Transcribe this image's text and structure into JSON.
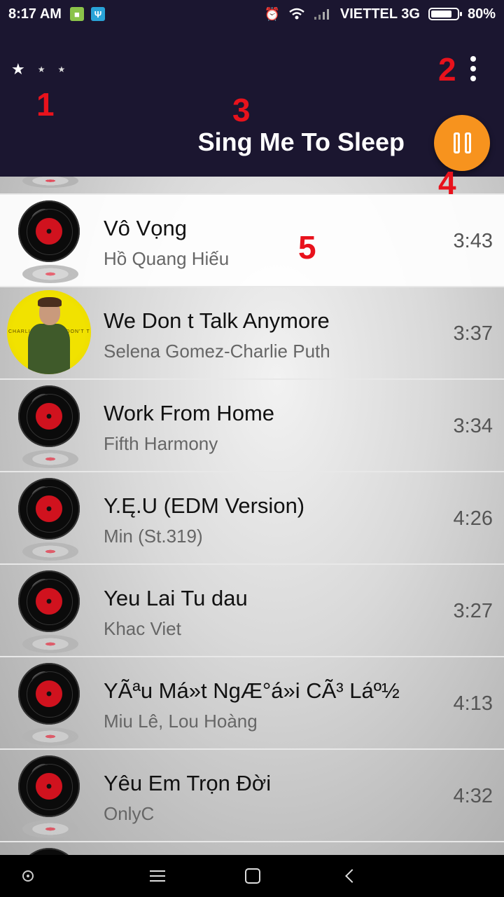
{
  "status_bar": {
    "time": "8:17 AM",
    "carrier": "VIETTEL 3G",
    "battery_level": "80%",
    "icons": [
      "android-icon",
      "usb-icon",
      "alarm-icon",
      "wifi-icon",
      "signal-icon",
      "battery-icon"
    ]
  },
  "header": {
    "now_playing_title": "Sing Me To Sleep",
    "accent_color": "#f7931e",
    "background_color": "#1b1630",
    "page_indicator": {
      "count": 3,
      "active_index": 0
    }
  },
  "annotations": [
    "1",
    "2",
    "3",
    "4",
    "5"
  ],
  "songs": [
    {
      "title": "Vô Vọng",
      "artist": "Hồ Quang Hiếu",
      "duration": "3:43",
      "thumb": "vinyl"
    },
    {
      "title": "We Don t Talk Anymore",
      "artist": "Selena Gomez-Charlie Puth",
      "duration": "3:37",
      "thumb": "album"
    },
    {
      "title": "Work From Home",
      "artist": "Fifth Harmony",
      "duration": "3:34",
      "thumb": "vinyl"
    },
    {
      "title": "Y.Ę.U (EDM Version)",
      "artist": "Min (St.319)",
      "duration": "4:26",
      "thumb": "vinyl"
    },
    {
      "title": "Yeu Lai Tu dau",
      "artist": "Khac Viet",
      "duration": "3:27",
      "thumb": "vinyl"
    },
    {
      "title": "YÃªu Má»t NgÆ°á»i CÃ³ Láº½",
      "artist": "Miu Lê, Lou Hoàng",
      "duration": "4:13",
      "thumb": "vinyl"
    },
    {
      "title": "Yêu Em Trọn Đời",
      "artist": "OnlyC",
      "duration": "4:32",
      "thumb": "vinyl"
    }
  ],
  "album_art_text": "CHARLIE PUTH WE DON'T TALK ANYMORE"
}
